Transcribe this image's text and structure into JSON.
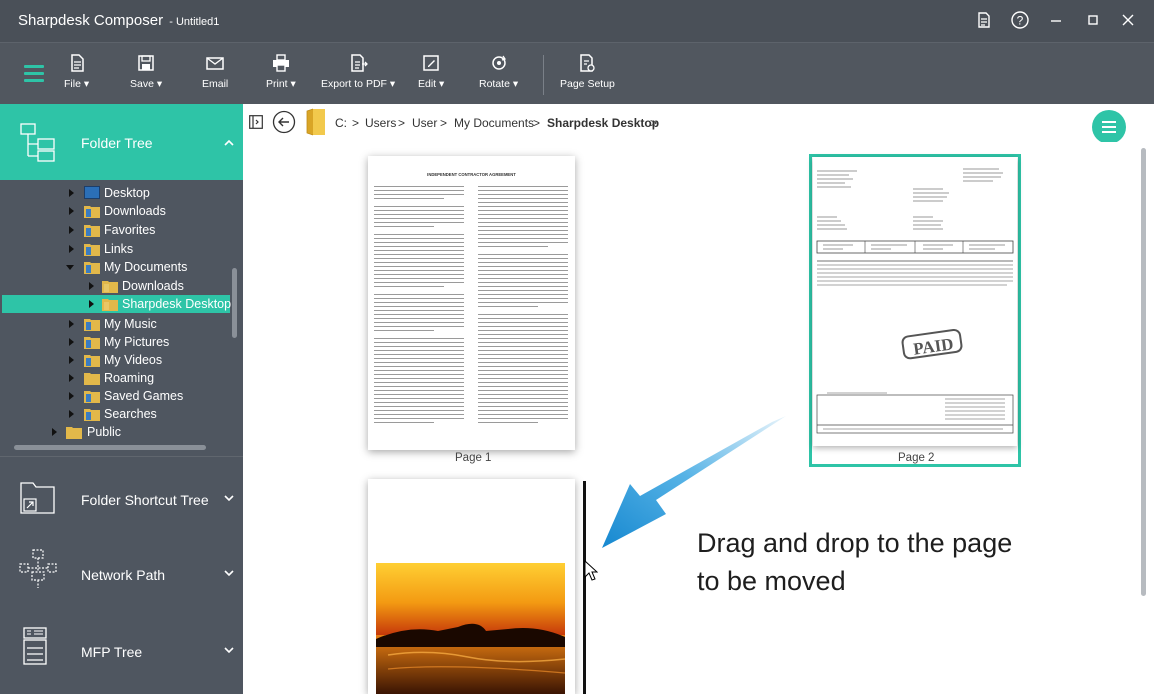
{
  "window": {
    "app_title": "Sharpdesk Composer",
    "doc_title": "- Untitled1"
  },
  "ribbon": {
    "buttons": [
      {
        "label": "File ▾",
        "icon": "file-icon"
      },
      {
        "label": "Save ▾",
        "icon": "save-icon"
      },
      {
        "label": "Email",
        "icon": "email-icon"
      },
      {
        "label": "Print ▾",
        "icon": "print-icon"
      },
      {
        "label": "Export to PDF ▾",
        "icon": "export-pdf-icon"
      },
      {
        "label": "Edit ▾",
        "icon": "edit-icon"
      },
      {
        "label": "Rotate ▾",
        "icon": "rotate-icon"
      },
      {
        "label": "Page Setup",
        "icon": "page-setup-icon"
      }
    ]
  },
  "sidebar": {
    "folder_tree": "Folder Tree",
    "folder_shortcut_tree": "Folder Shortcut Tree",
    "network_path": "Network Path",
    "mfp_tree": "MFP Tree",
    "tree": [
      {
        "label": "Desktop"
      },
      {
        "label": "Downloads"
      },
      {
        "label": "Favorites"
      },
      {
        "label": "Links"
      },
      {
        "label": "My Documents"
      },
      {
        "label": "Downloads"
      },
      {
        "label": "Sharpdesk Desktop"
      },
      {
        "label": "My Music"
      },
      {
        "label": "My Pictures"
      },
      {
        "label": "My Videos"
      },
      {
        "label": "Roaming"
      },
      {
        "label": "Saved Games"
      },
      {
        "label": "Searches"
      },
      {
        "label": "Public"
      }
    ]
  },
  "path": {
    "segments": [
      "C:",
      "Users",
      "User",
      "My Documents",
      "Sharpdesk Desktop"
    ],
    "separator": ">"
  },
  "pages": {
    "page1_label": "Page 1",
    "page2_label": "Page 2",
    "page1_heading": "INDEPENDENT CONTRACTOR AGREEMENT",
    "page2_stamp": "PAID"
  },
  "callout": {
    "text": "Drag and drop to the page to be moved"
  },
  "colors": {
    "accent": "#2ec4a7",
    "titlebar": "#4a5058",
    "sidebar": "#4f5660",
    "arrow": "#1a8fd1"
  }
}
